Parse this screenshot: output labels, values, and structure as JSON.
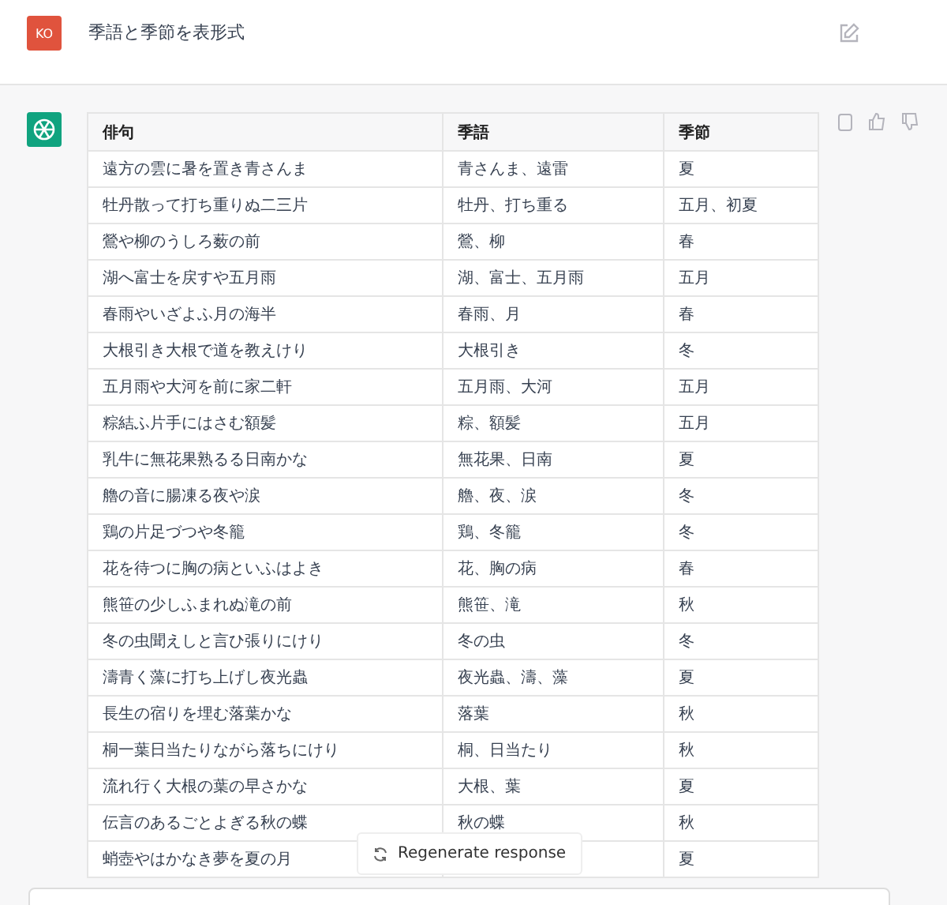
{
  "user_message": {
    "avatar": "KO",
    "text": "季語と季節を表形式"
  },
  "table": {
    "columns": [
      "俳句",
      "季語",
      "季節"
    ],
    "rows": [
      {
        "haiku": "遠方の雲に暑を置き青さんま",
        "kigo": "青さんま、遠雷",
        "season": "夏"
      },
      {
        "haiku": "牡丹散って打ち重りぬ二三片",
        "kigo": "牡丹、打ち重る",
        "season": "五月、初夏"
      },
      {
        "haiku": "鶯や柳のうしろ薮の前",
        "kigo": "鶯、柳",
        "season": "春"
      },
      {
        "haiku": "湖へ富士を戻すや五月雨",
        "kigo": "湖、富士、五月雨",
        "season": "五月"
      },
      {
        "haiku": "春雨やいざよふ月の海半",
        "kigo": "春雨、月",
        "season": "春"
      },
      {
        "haiku": "大根引き大根で道を教えけり",
        "kigo": "大根引き",
        "season": "冬"
      },
      {
        "haiku": "五月雨や大河を前に家二軒",
        "kigo": "五月雨、大河",
        "season": "五月"
      },
      {
        "haiku": "粽結ふ片手にはさむ額髪",
        "kigo": "粽、額髪",
        "season": "五月"
      },
      {
        "haiku": "乳牛に無花果熟るる日南かな",
        "kigo": "無花果、日南",
        "season": "夏"
      },
      {
        "haiku": "艪の音に腸凍る夜や涙",
        "kigo": "艪、夜、涙",
        "season": "冬"
      },
      {
        "haiku": "鶏の片足づつや冬籠",
        "kigo": "鶏、冬籠",
        "season": "冬"
      },
      {
        "haiku": "花を待つに胸の病といふはよき",
        "kigo": "花、胸の病",
        "season": "春"
      },
      {
        "haiku": "熊笹の少しふまれぬ滝の前",
        "kigo": "熊笹、滝",
        "season": "秋"
      },
      {
        "haiku": "冬の虫聞えしと言ひ張りにけり",
        "kigo": "冬の虫",
        "season": "冬"
      },
      {
        "haiku": "濤青く藻に打ち上げし夜光蟲",
        "kigo": "夜光蟲、濤、藻",
        "season": "夏"
      },
      {
        "haiku": "長生の宿りを埋む落葉かな",
        "kigo": "落葉",
        "season": "秋"
      },
      {
        "haiku": "桐一葉日当たりながら落ちにけり",
        "kigo": "桐、日当たり",
        "season": "秋"
      },
      {
        "haiku": "流れ行く大根の葉の早さかな",
        "kigo": "大根、葉",
        "season": "夏"
      },
      {
        "haiku": "伝言のあるごとよぎる秋の蝶",
        "kigo": "秋の蝶",
        "season": "秋"
      },
      {
        "haiku": "蛸壺やはかなき夢を夏の月",
        "season": "夏"
      }
    ]
  },
  "regenerate_button": "Regenerate response"
}
